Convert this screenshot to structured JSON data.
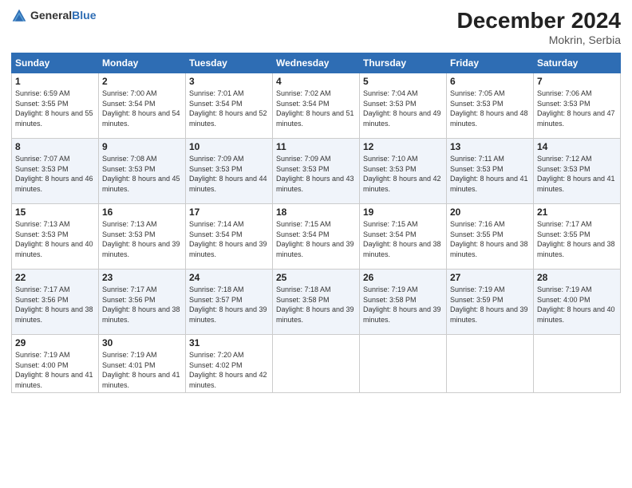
{
  "header": {
    "logo_general": "General",
    "logo_blue": "Blue",
    "month_year": "December 2024",
    "location": "Mokrin, Serbia"
  },
  "days_of_week": [
    "Sunday",
    "Monday",
    "Tuesday",
    "Wednesday",
    "Thursday",
    "Friday",
    "Saturday"
  ],
  "weeks": [
    [
      {
        "day": "1",
        "sunrise": "Sunrise: 6:59 AM",
        "sunset": "Sunset: 3:55 PM",
        "daylight": "Daylight: 8 hours and 55 minutes."
      },
      {
        "day": "2",
        "sunrise": "Sunrise: 7:00 AM",
        "sunset": "Sunset: 3:54 PM",
        "daylight": "Daylight: 8 hours and 54 minutes."
      },
      {
        "day": "3",
        "sunrise": "Sunrise: 7:01 AM",
        "sunset": "Sunset: 3:54 PM",
        "daylight": "Daylight: 8 hours and 52 minutes."
      },
      {
        "day": "4",
        "sunrise": "Sunrise: 7:02 AM",
        "sunset": "Sunset: 3:54 PM",
        "daylight": "Daylight: 8 hours and 51 minutes."
      },
      {
        "day": "5",
        "sunrise": "Sunrise: 7:04 AM",
        "sunset": "Sunset: 3:53 PM",
        "daylight": "Daylight: 8 hours and 49 minutes."
      },
      {
        "day": "6",
        "sunrise": "Sunrise: 7:05 AM",
        "sunset": "Sunset: 3:53 PM",
        "daylight": "Daylight: 8 hours and 48 minutes."
      },
      {
        "day": "7",
        "sunrise": "Sunrise: 7:06 AM",
        "sunset": "Sunset: 3:53 PM",
        "daylight": "Daylight: 8 hours and 47 minutes."
      }
    ],
    [
      {
        "day": "8",
        "sunrise": "Sunrise: 7:07 AM",
        "sunset": "Sunset: 3:53 PM",
        "daylight": "Daylight: 8 hours and 46 minutes."
      },
      {
        "day": "9",
        "sunrise": "Sunrise: 7:08 AM",
        "sunset": "Sunset: 3:53 PM",
        "daylight": "Daylight: 8 hours and 45 minutes."
      },
      {
        "day": "10",
        "sunrise": "Sunrise: 7:09 AM",
        "sunset": "Sunset: 3:53 PM",
        "daylight": "Daylight: 8 hours and 44 minutes."
      },
      {
        "day": "11",
        "sunrise": "Sunrise: 7:09 AM",
        "sunset": "Sunset: 3:53 PM",
        "daylight": "Daylight: 8 hours and 43 minutes."
      },
      {
        "day": "12",
        "sunrise": "Sunrise: 7:10 AM",
        "sunset": "Sunset: 3:53 PM",
        "daylight": "Daylight: 8 hours and 42 minutes."
      },
      {
        "day": "13",
        "sunrise": "Sunrise: 7:11 AM",
        "sunset": "Sunset: 3:53 PM",
        "daylight": "Daylight: 8 hours and 41 minutes."
      },
      {
        "day": "14",
        "sunrise": "Sunrise: 7:12 AM",
        "sunset": "Sunset: 3:53 PM",
        "daylight": "Daylight: 8 hours and 41 minutes."
      }
    ],
    [
      {
        "day": "15",
        "sunrise": "Sunrise: 7:13 AM",
        "sunset": "Sunset: 3:53 PM",
        "daylight": "Daylight: 8 hours and 40 minutes."
      },
      {
        "day": "16",
        "sunrise": "Sunrise: 7:13 AM",
        "sunset": "Sunset: 3:53 PM",
        "daylight": "Daylight: 8 hours and 39 minutes."
      },
      {
        "day": "17",
        "sunrise": "Sunrise: 7:14 AM",
        "sunset": "Sunset: 3:54 PM",
        "daylight": "Daylight: 8 hours and 39 minutes."
      },
      {
        "day": "18",
        "sunrise": "Sunrise: 7:15 AM",
        "sunset": "Sunset: 3:54 PM",
        "daylight": "Daylight: 8 hours and 39 minutes."
      },
      {
        "day": "19",
        "sunrise": "Sunrise: 7:15 AM",
        "sunset": "Sunset: 3:54 PM",
        "daylight": "Daylight: 8 hours and 38 minutes."
      },
      {
        "day": "20",
        "sunrise": "Sunrise: 7:16 AM",
        "sunset": "Sunset: 3:55 PM",
        "daylight": "Daylight: 8 hours and 38 minutes."
      },
      {
        "day": "21",
        "sunrise": "Sunrise: 7:17 AM",
        "sunset": "Sunset: 3:55 PM",
        "daylight": "Daylight: 8 hours and 38 minutes."
      }
    ],
    [
      {
        "day": "22",
        "sunrise": "Sunrise: 7:17 AM",
        "sunset": "Sunset: 3:56 PM",
        "daylight": "Daylight: 8 hours and 38 minutes."
      },
      {
        "day": "23",
        "sunrise": "Sunrise: 7:17 AM",
        "sunset": "Sunset: 3:56 PM",
        "daylight": "Daylight: 8 hours and 38 minutes."
      },
      {
        "day": "24",
        "sunrise": "Sunrise: 7:18 AM",
        "sunset": "Sunset: 3:57 PM",
        "daylight": "Daylight: 8 hours and 39 minutes."
      },
      {
        "day": "25",
        "sunrise": "Sunrise: 7:18 AM",
        "sunset": "Sunset: 3:58 PM",
        "daylight": "Daylight: 8 hours and 39 minutes."
      },
      {
        "day": "26",
        "sunrise": "Sunrise: 7:19 AM",
        "sunset": "Sunset: 3:58 PM",
        "daylight": "Daylight: 8 hours and 39 minutes."
      },
      {
        "day": "27",
        "sunrise": "Sunrise: 7:19 AM",
        "sunset": "Sunset: 3:59 PM",
        "daylight": "Daylight: 8 hours and 39 minutes."
      },
      {
        "day": "28",
        "sunrise": "Sunrise: 7:19 AM",
        "sunset": "Sunset: 4:00 PM",
        "daylight": "Daylight: 8 hours and 40 minutes."
      }
    ],
    [
      {
        "day": "29",
        "sunrise": "Sunrise: 7:19 AM",
        "sunset": "Sunset: 4:00 PM",
        "daylight": "Daylight: 8 hours and 41 minutes."
      },
      {
        "day": "30",
        "sunrise": "Sunrise: 7:19 AM",
        "sunset": "Sunset: 4:01 PM",
        "daylight": "Daylight: 8 hours and 41 minutes."
      },
      {
        "day": "31",
        "sunrise": "Sunrise: 7:20 AM",
        "sunset": "Sunset: 4:02 PM",
        "daylight": "Daylight: 8 hours and 42 minutes."
      },
      null,
      null,
      null,
      null
    ]
  ]
}
